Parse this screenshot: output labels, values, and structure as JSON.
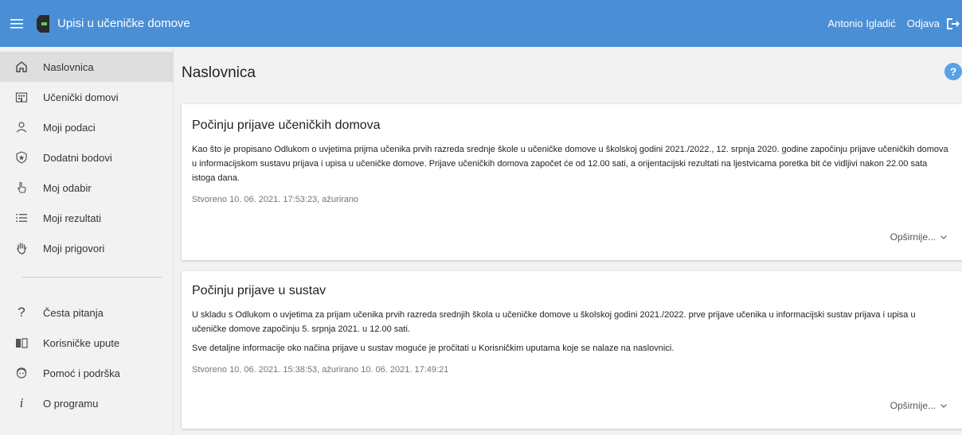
{
  "app": {
    "title": "Upisi u učeničke domove",
    "user": "Antonio Igladić",
    "logout_label": "Odjava",
    "accent": "#4a8fd6"
  },
  "sidebar": {
    "items": [
      {
        "label": "Naslovnica",
        "icon": "home-icon"
      },
      {
        "label": "Učenički domovi",
        "icon": "building-icon"
      },
      {
        "label": "Moji podaci",
        "icon": "person-icon"
      },
      {
        "label": "Dodatni bodovi",
        "icon": "shield-star-icon"
      },
      {
        "label": "Moj odabir",
        "icon": "touch-icon"
      },
      {
        "label": "Moji rezultati",
        "icon": "list-icon"
      },
      {
        "label": "Moji prigovori",
        "icon": "hand-icon"
      }
    ],
    "secondary": [
      {
        "label": "Česta pitanja",
        "icon": "question-icon"
      },
      {
        "label": "Korisničke upute",
        "icon": "book-icon"
      },
      {
        "label": "Pomoć i podrška",
        "icon": "support-icon"
      },
      {
        "label": "O programu",
        "icon": "info-icon"
      }
    ]
  },
  "main": {
    "title": "Naslovnica",
    "help": "?",
    "cards": [
      {
        "title": "Počinju prijave učeničkih domova",
        "paragraphs": [
          "Kao što je propisano Odlukom o uvjetima prijma učenika prvih razreda srednje škole u učeničke domove u školskoj godini 2021./2022., 12. srpnja 2020. godine započinju prijave učeničkih domova u informacijskom sustavu prijava i upisa u učeničke domove. Prijave učeničkih domova započet će od 12.00 sati, a orijentacijski rezultati na ljestvicama poretka bit će vidljivi nakon 22.00 sata istoga dana."
        ],
        "meta": "Stvoreno 10. 06. 2021. 17:53:23, ažurirano",
        "more": "Opširnije..."
      },
      {
        "title": "Počinju prijave u sustav",
        "paragraphs": [
          "U skladu s Odlukom o uvjetima za prijam učenika prvih razreda srednjih škola u učeničke domove u školskoj godini 2021./2022. prve prijave učenika u informacijski sustav prijava i upisa u učeničke domove započinju 5. srpnja 2021. u 12.00 sati.",
          "Sve detaljne informacije oko načina prijave u sustav moguće je pročitati u Korisničkim uputama koje se nalaze na naslovnici."
        ],
        "meta": "Stvoreno 10. 06. 2021. 15:38:53, ažurirano 10. 06. 2021. 17:49:21",
        "more": "Opširnije..."
      }
    ]
  }
}
